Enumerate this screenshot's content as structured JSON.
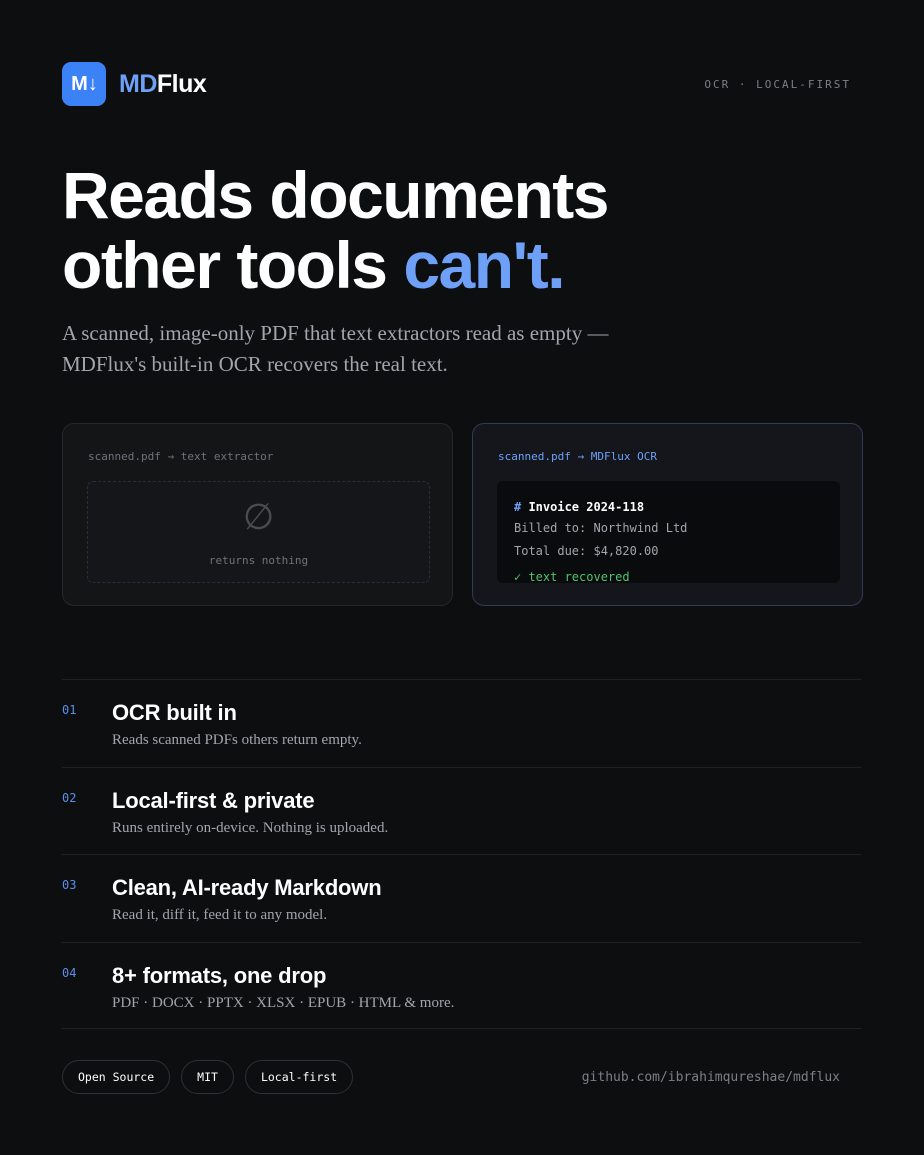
{
  "header": {
    "logo_letter": "M",
    "logo_arrow": "↓",
    "brand_md": "MD",
    "brand_flux": "Flux",
    "tagline": "OCR · LOCAL-FIRST"
  },
  "hero": {
    "title_line1": "Reads documents",
    "title_line2_start": "other tools ",
    "title_line2_accent": "can't.",
    "subtitle_line1": "A scanned, image-only PDF that text extractors read as empty —",
    "subtitle_line2": "MDFlux's built-in OCR recovers the real text."
  },
  "compare": {
    "left": {
      "label": "scanned.pdf → text extractor",
      "symbol": "∅",
      "result": "returns nothing"
    },
    "right": {
      "label": "scanned.pdf → MDFlux OCR",
      "heading_hash": "#",
      "heading_text": " Invoice 2024-118",
      "line1": "Billed to: Northwind Ltd",
      "line2": "Total due: $4,820.00",
      "status": "✓ text recovered"
    }
  },
  "features": [
    {
      "num": "01",
      "title": "OCR built in",
      "desc": "Reads scanned PDFs others return empty."
    },
    {
      "num": "02",
      "title": "Local-first & private",
      "desc": "Runs entirely on-device. Nothing is uploaded."
    },
    {
      "num": "03",
      "title": "Clean, AI-ready Markdown",
      "desc": "Read it, diff it, feed it to any model."
    },
    {
      "num": "04",
      "title": "8+ formats, one drop",
      "desc": "PDF · DOCX · PPTX · XLSX · EPUB · HTML & more."
    }
  ],
  "footer": {
    "badges": [
      "Open Source",
      "MIT",
      "Local-first"
    ],
    "repo": "github.com/ibrahimqureshae/mdflux"
  },
  "colors": {
    "background": "#0d0e10",
    "accent": "#3b82f6",
    "accent_text": "#6ea0f7",
    "success": "#4fc36e"
  }
}
